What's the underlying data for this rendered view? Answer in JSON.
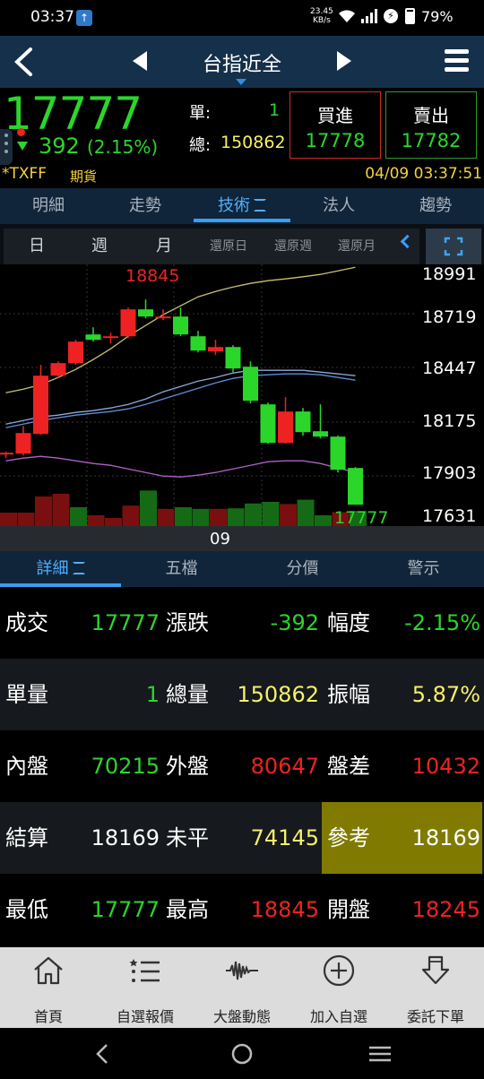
{
  "status_bar": {
    "time": "03:37",
    "net_speed_value": "23.45",
    "net_speed_unit": "KB/s",
    "battery": "79%"
  },
  "header": {
    "title": "台指近全"
  },
  "quote": {
    "last": "17777",
    "change": "392",
    "change_pct": "(2.15%)",
    "single_label": "單:",
    "single_value": "1",
    "total_label": "總:",
    "total_value": "150862",
    "buy_label": "買進",
    "buy_price": "17778",
    "sell_label": "賣出",
    "sell_price": "17782",
    "symbol": "*TXFF",
    "market": "期貨",
    "datetime": "04/09 03:37:51"
  },
  "main_tabs": [
    {
      "label": "明細"
    },
    {
      "label": "走勢"
    },
    {
      "label": "技術"
    },
    {
      "label": "法人"
    },
    {
      "label": "趨勢"
    }
  ],
  "periods": [
    {
      "label": "日"
    },
    {
      "label": "週"
    },
    {
      "label": "月"
    },
    {
      "label": "還原日"
    },
    {
      "label": "還原週"
    },
    {
      "label": "還原月"
    }
  ],
  "chart_data": {
    "type": "candlestick",
    "y_ticks": [
      "18991",
      "18719",
      "18447",
      "18175",
      "17903",
      "17631"
    ],
    "x_label": "09",
    "annotations": {
      "high": "18845",
      "last": "17777"
    },
    "candles": [
      {
        "o": 17990,
        "c": 17990,
        "h": 17995,
        "l": 17960,
        "dir": "up"
      },
      {
        "o": 17985,
        "c": 18100,
        "h": 18140,
        "l": 17975,
        "dir": "up"
      },
      {
        "o": 18095,
        "c": 18420,
        "h": 18480,
        "l": 18090,
        "dir": "up"
      },
      {
        "o": 18420,
        "c": 18490,
        "h": 18500,
        "l": 18410,
        "dir": "up"
      },
      {
        "o": 18490,
        "c": 18610,
        "h": 18620,
        "l": 18480,
        "dir": "up"
      },
      {
        "o": 18620,
        "c": 18650,
        "h": 18690,
        "l": 18610,
        "dir": "down"
      },
      {
        "o": 18630,
        "c": 18640,
        "h": 18660,
        "l": 18600,
        "dir": "up"
      },
      {
        "o": 18640,
        "c": 18790,
        "h": 18800,
        "l": 18630,
        "dir": "up"
      },
      {
        "o": 18790,
        "c": 18750,
        "h": 18845,
        "l": 18740,
        "dir": "down"
      },
      {
        "o": 18750,
        "c": 18745,
        "h": 18790,
        "l": 18730,
        "dir": "up"
      },
      {
        "o": 18750,
        "c": 18650,
        "h": 18800,
        "l": 18640,
        "dir": "down"
      },
      {
        "o": 18640,
        "c": 18560,
        "h": 18670,
        "l": 18550,
        "dir": "down"
      },
      {
        "o": 18555,
        "c": 18580,
        "h": 18620,
        "l": 18535,
        "dir": "up"
      },
      {
        "o": 18580,
        "c": 18460,
        "h": 18590,
        "l": 18440,
        "dir": "down"
      },
      {
        "o": 18470,
        "c": 18280,
        "h": 18500,
        "l": 18265,
        "dir": "down"
      },
      {
        "o": 18260,
        "c": 18045,
        "h": 18270,
        "l": 18040,
        "dir": "down"
      },
      {
        "o": 18045,
        "c": 18220,
        "h": 18300,
        "l": 18040,
        "dir": "up"
      },
      {
        "o": 18220,
        "c": 18105,
        "h": 18240,
        "l": 18085,
        "dir": "down"
      },
      {
        "o": 18110,
        "c": 18080,
        "h": 18260,
        "l": 18070,
        "dir": "down"
      },
      {
        "o": 18080,
        "c": 17895,
        "h": 18085,
        "l": 17880,
        "dir": "down"
      },
      {
        "o": 17905,
        "c": 17700,
        "h": 17910,
        "l": 17700,
        "dir": "down"
      }
    ],
    "ma_upper": [
      18325,
      18345,
      18370,
      18410,
      18455,
      18510,
      18570,
      18640,
      18700,
      18760,
      18810,
      18860,
      18890,
      18915,
      18935,
      18950,
      18960,
      18972,
      18985,
      19005,
      19025
    ],
    "ma_mid": [
      18150,
      18170,
      18190,
      18200,
      18215,
      18225,
      18240,
      18260,
      18290,
      18330,
      18360,
      18390,
      18410,
      18435,
      18450,
      18450,
      18450,
      18450,
      18440,
      18430,
      18420
    ],
    "ma_mid2": [
      18130,
      18150,
      18170,
      18185,
      18200,
      18210,
      18220,
      18235,
      18260,
      18290,
      18320,
      18350,
      18380,
      18405,
      18420,
      18425,
      18430,
      18430,
      18425,
      18410,
      18395
    ],
    "ma_lower": [
      17945,
      17960,
      17970,
      17960,
      17945,
      17930,
      17920,
      17900,
      17880,
      17860,
      17855,
      17865,
      17880,
      17900,
      17920,
      17940,
      17945,
      17945,
      17930,
      17905,
      17880
    ],
    "volumes": [
      0.25,
      0.25,
      0.55,
      0.6,
      0.35,
      0.2,
      0.15,
      0.38,
      0.66,
      0.32,
      0.35,
      0.32,
      0.32,
      0.33,
      0.42,
      0.45,
      0.41,
      0.49,
      0.2,
      0.26,
      0.28
    ],
    "vol_dir": [
      "down",
      "down",
      "down",
      "down",
      "up",
      "down",
      "down",
      "down",
      "up",
      "down",
      "up",
      "up",
      "down",
      "up",
      "up",
      "up",
      "down",
      "up",
      "up",
      "down",
      "up"
    ],
    "ylim": [
      17631,
      18991
    ]
  },
  "detail_tabs": [
    {
      "label": "詳細"
    },
    {
      "label": "五檔"
    },
    {
      "label": "分價"
    },
    {
      "label": "警示"
    }
  ],
  "stats": {
    "r1": {
      "l1": "成交",
      "v1": "17777",
      "l2": "漲跌",
      "v2": "-392",
      "l3": "幅度",
      "v3": "-2.15%"
    },
    "r2": {
      "l1": "單量",
      "v1": "1",
      "l2": "總量",
      "v2": "150862",
      "l3": "振幅",
      "v3": "5.87%"
    },
    "r3": {
      "l1": "內盤",
      "v1": "70215",
      "l2": "外盤",
      "v2": "80647",
      "l3": "盤差",
      "v3": "10432"
    },
    "r4": {
      "l1": "結算",
      "v1": "18169",
      "l2": "未平",
      "v2": "74145",
      "l3": "參考",
      "v3": "18169"
    },
    "r5": {
      "l1": "最低",
      "v1": "17777",
      "l2": "最高",
      "v2": "18845",
      "l3": "開盤",
      "v3": "18245"
    }
  },
  "bottom_nav": [
    {
      "label": "首頁"
    },
    {
      "label": "自選報價"
    },
    {
      "label": "大盤動態"
    },
    {
      "label": "加入自選"
    },
    {
      "label": "委託下單"
    }
  ],
  "colors": {
    "up": "#ee2222",
    "down": "#2bd62b",
    "accent": "#3a9ef0",
    "highlight": "#807b00"
  }
}
